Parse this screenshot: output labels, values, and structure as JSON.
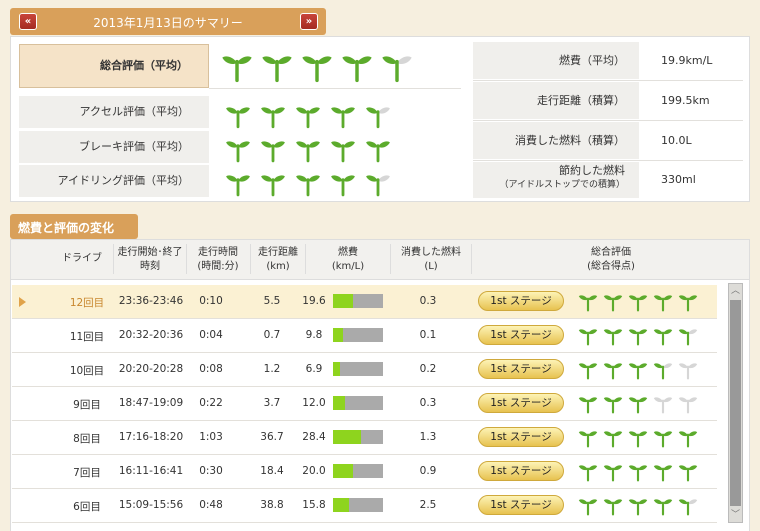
{
  "summary": {
    "title": "2013年1月13日のサマリー",
    "prev_icon": "double-left-arrow-icon",
    "next_icon": "double-right-arrow-icon",
    "evaluations": [
      {
        "label": "総合評価（平均）",
        "rating": 4.5
      },
      {
        "label": "アクセル評価（平均）",
        "rating": 4.5
      },
      {
        "label": "ブレーキ評価（平均）",
        "rating": 5
      },
      {
        "label": "アイドリング評価（平均）",
        "rating": 4.5
      }
    ],
    "stats": [
      {
        "label": "燃費（平均）",
        "value": "19.9km/L"
      },
      {
        "label": "走行距離（積算）",
        "value": "199.5km"
      },
      {
        "label": "消費した燃料（積算）",
        "value": "10.0L"
      },
      {
        "label": "節約した燃料",
        "sublabel": "（アイドルストップでの積算）",
        "value": "330ml"
      }
    ]
  },
  "changes": {
    "title": "燃費と評価の変化",
    "headers": [
      {
        "l1": "ドライブ",
        "l2": ""
      },
      {
        "l1": "走行開始･終了",
        "l2": "時刻"
      },
      {
        "l1": "走行時間",
        "l2": "(時間:分)"
      },
      {
        "l1": "走行距離",
        "l2": "(km)"
      },
      {
        "l1": "燃費",
        "l2": "(km/L)"
      },
      {
        "l1": "消費した燃料",
        "l2": "(L)"
      },
      {
        "l1": "総合評価",
        "l2": "(総合得点)"
      }
    ],
    "rows": [
      {
        "drive": "12回目",
        "time": "23:36-23:46",
        "duration": "0:10",
        "distance": "5.5",
        "fuel_eff": "19.6",
        "fuel_used": "0.3",
        "stage": "1st ステージ",
        "rating": 5,
        "selected": true
      },
      {
        "drive": "11回目",
        "time": "20:32-20:36",
        "duration": "0:04",
        "distance": "0.7",
        "fuel_eff": "9.8",
        "fuel_used": "0.1",
        "stage": "1st ステージ",
        "rating": 4.5
      },
      {
        "drive": "10回目",
        "time": "20:20-20:28",
        "duration": "0:08",
        "distance": "1.2",
        "fuel_eff": "6.9",
        "fuel_used": "0.2",
        "stage": "1st ステージ",
        "rating": 3.5
      },
      {
        "drive": "9回目",
        "time": "18:47-19:09",
        "duration": "0:22",
        "distance": "3.7",
        "fuel_eff": "12.0",
        "fuel_used": "0.3",
        "stage": "1st ステージ",
        "rating": 3
      },
      {
        "drive": "8回目",
        "time": "17:16-18:20",
        "duration": "1:03",
        "distance": "36.7",
        "fuel_eff": "28.4",
        "fuel_used": "1.3",
        "stage": "1st ステージ",
        "rating": 5
      },
      {
        "drive": "7回目",
        "time": "16:11-16:41",
        "duration": "0:30",
        "distance": "18.4",
        "fuel_eff": "20.0",
        "fuel_used": "0.9",
        "stage": "1st ステージ",
        "rating": 5
      },
      {
        "drive": "6回目",
        "time": "15:09-15:56",
        "duration": "0:48",
        "distance": "38.8",
        "fuel_eff": "15.8",
        "fuel_used": "2.5",
        "stage": "1st ステージ",
        "rating": 4.5
      }
    ],
    "bar_max": 50
  },
  "colors": {
    "sprout": "#5cab2c",
    "sprout_off": "#d6d6d6",
    "bar_fill": "#8ed41e",
    "header": "#d9a05a"
  }
}
